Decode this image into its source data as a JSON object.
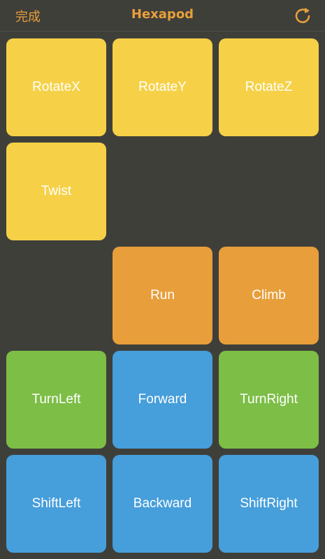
{
  "navbar": {
    "done_label": "完成",
    "title": "Hexapod",
    "refresh_icon": "refresh-icon"
  },
  "colors": {
    "background": "#3f3f3a",
    "accent": "#e89f3a",
    "yellow": "#f6d147",
    "orange": "#e89e3a",
    "green": "#7cbe46",
    "blue": "#469edb"
  },
  "buttons": {
    "rotate_x": "RotateX",
    "rotate_y": "RotateY",
    "rotate_z": "RotateZ",
    "twist": "Twist",
    "run": "Run",
    "climb": "Climb",
    "turn_left": "TurnLeft",
    "forward": "Forward",
    "turn_right": "TurnRight",
    "shift_left": "ShiftLeft",
    "backward": "Backward",
    "shift_right": "ShiftRight"
  }
}
